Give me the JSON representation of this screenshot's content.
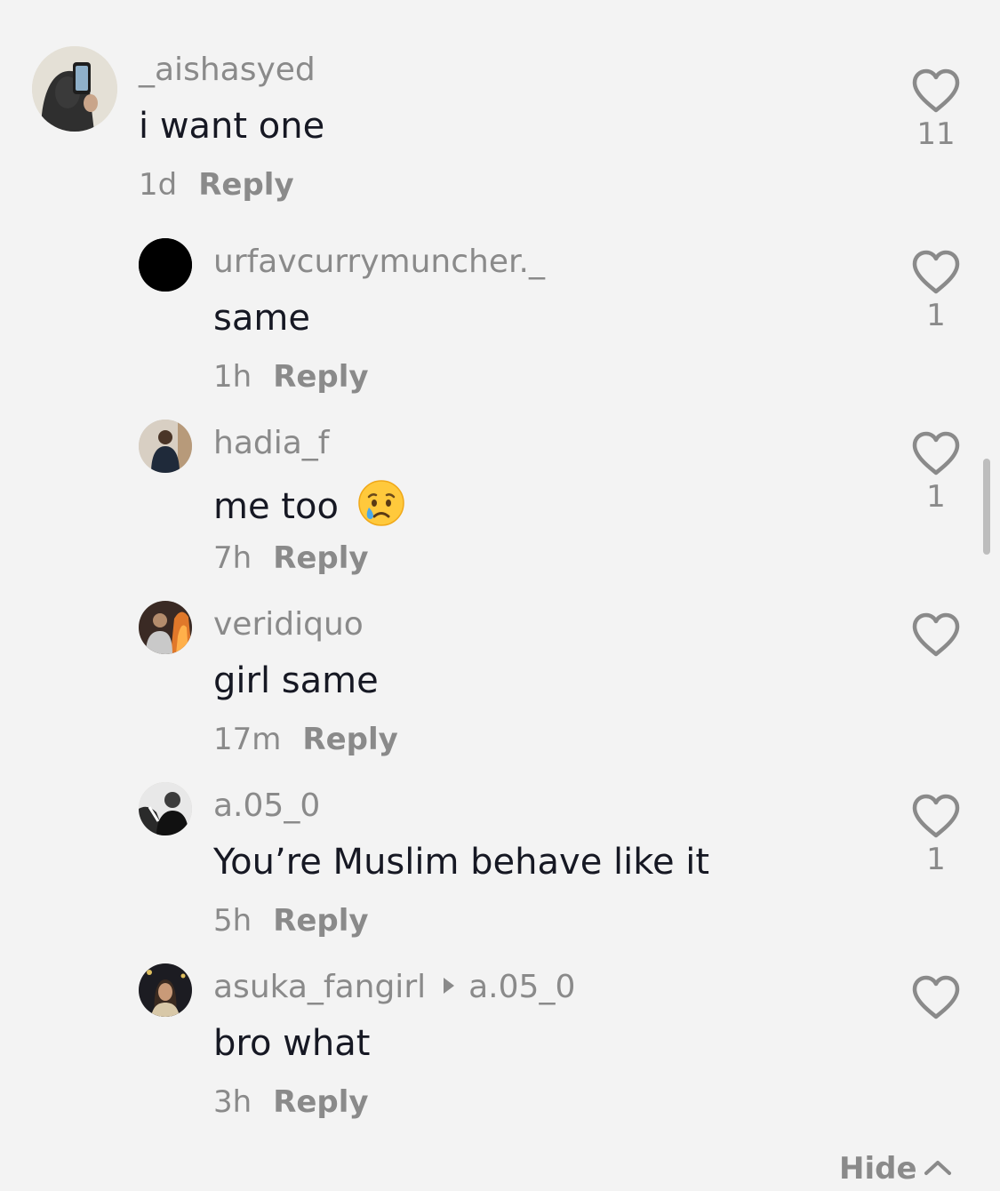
{
  "comments": [
    {
      "username": "_aishasyed",
      "text": "i want one",
      "time": "1d",
      "reply_label": "Reply",
      "likes": "11",
      "avatar_icon": "selfie-avatar"
    },
    {
      "username": "urfavcurrymuncher._",
      "text": "same",
      "time": "1h",
      "reply_label": "Reply",
      "likes": "1",
      "avatar_icon": "black-circle-avatar"
    },
    {
      "username": "hadia_f",
      "text": "me too",
      "emoji": "😢",
      "time": "7h",
      "reply_label": "Reply",
      "likes": "1",
      "avatar_icon": "person-avatar"
    },
    {
      "username": "veridiquo",
      "text": "girl same",
      "time": "17m",
      "reply_label": "Reply",
      "likes": "",
      "avatar_icon": "person-fire-avatar"
    },
    {
      "username": "a.05_0",
      "text": "You’re Muslim behave like it",
      "time": "5h",
      "reply_label": "Reply",
      "likes": "1",
      "avatar_icon": "bw-person-avatar"
    },
    {
      "username": "asuka_fangirl",
      "reply_to": "a.05_0",
      "text": "bro what",
      "time": "3h",
      "reply_label": "Reply",
      "likes": "",
      "avatar_icon": "person-dark-avatar"
    }
  ],
  "hide_label": "Hide",
  "colors": {
    "background": "#f3f3f3",
    "text": "#161823",
    "secondary": "#8a8a8a"
  }
}
